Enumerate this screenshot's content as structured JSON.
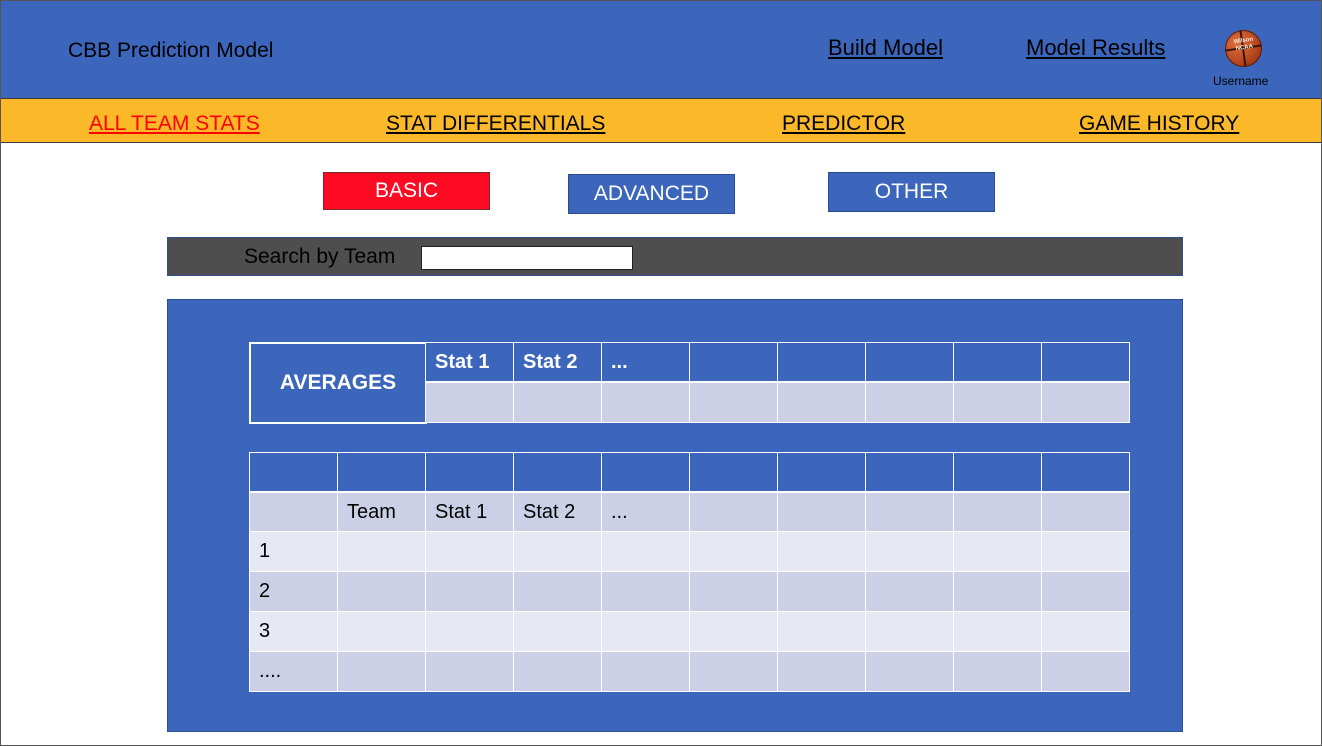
{
  "header": {
    "title": "CBB Prediction Model",
    "links": [
      "Build Model",
      "Model Results"
    ],
    "username": "Username",
    "avatar_icon": "basketball-icon",
    "ball_brand": "Wilson",
    "ball_mark": "NCAA"
  },
  "nav": {
    "items": [
      "ALL TEAM STATS",
      "STAT DIFFERENTIALS",
      "PREDICTOR",
      "GAME HISTORY"
    ],
    "active": "ALL TEAM STATS"
  },
  "subtabs": {
    "items": [
      "BASIC",
      "ADVANCED",
      "OTHER"
    ],
    "active": "BASIC"
  },
  "search": {
    "label": "Search by Team",
    "value": ""
  },
  "averages_table": {
    "label": "AVERAGES",
    "headers": [
      "Stat 1",
      "Stat 2",
      "...",
      "",
      "",
      "",
      "",
      ""
    ]
  },
  "stats_table": {
    "headers": [
      "",
      "Team",
      "Stat 1",
      "Stat 2",
      "...",
      "",
      "",
      "",
      "",
      ""
    ],
    "rows": [
      "1",
      "2",
      "3",
      "...."
    ]
  },
  "colors": {
    "header_blue": "#3b66bb",
    "nav_yellow": "#fbb829",
    "active_red": "#ff0000",
    "basic_red": "#ff0a23"
  }
}
